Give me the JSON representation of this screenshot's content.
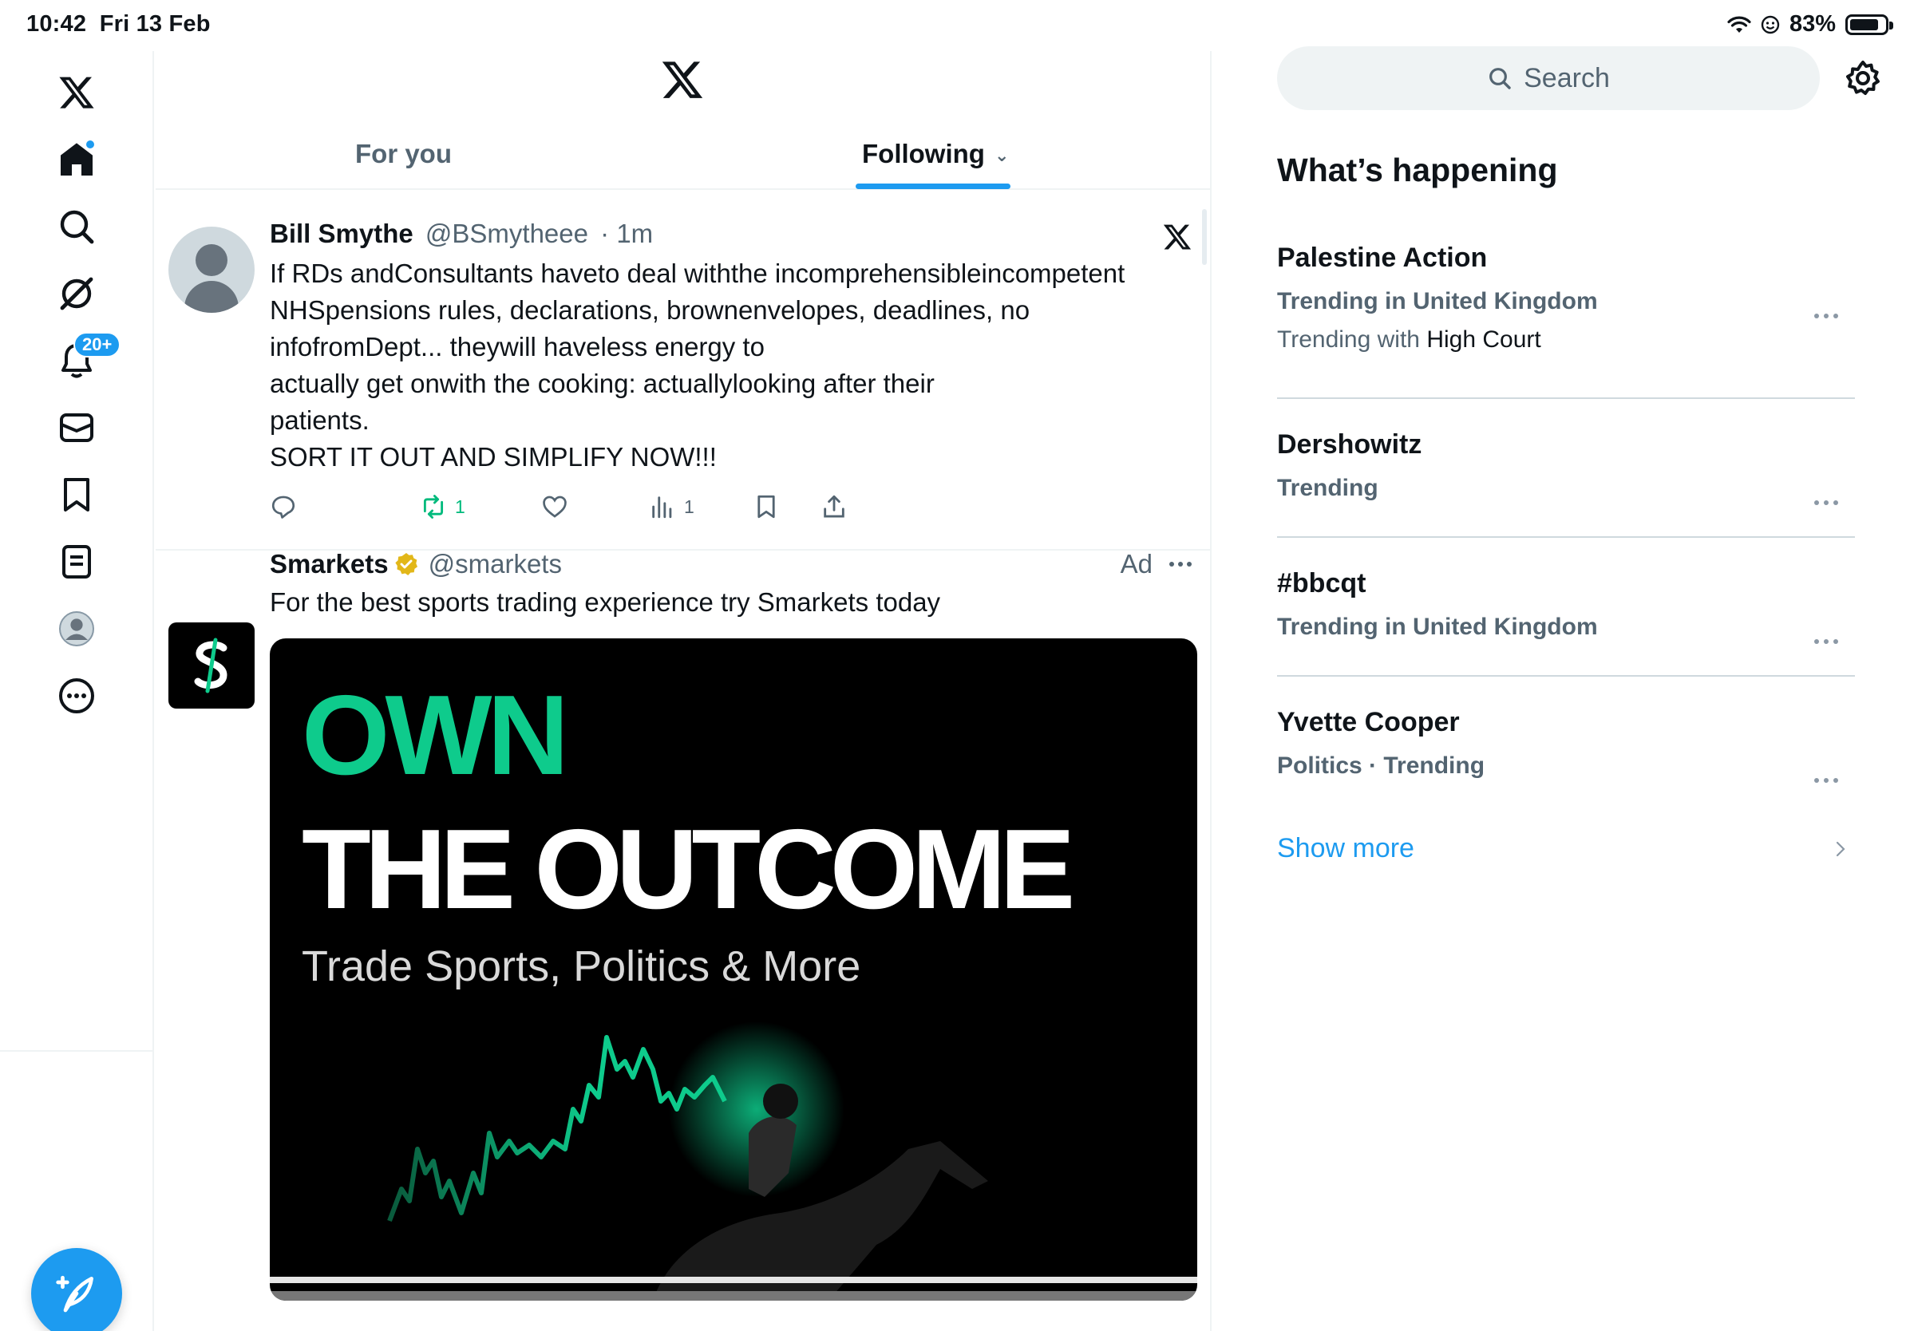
{
  "status": {
    "time": "10:42",
    "date": "Fri 13 Feb",
    "battery": "83%",
    "battery_level": 0.83
  },
  "nav": {
    "notifications_badge": "20+"
  },
  "tabs": {
    "for_you": "For you",
    "following": "Following"
  },
  "tweet": {
    "name": "Bill Smythe",
    "handle": "@BSmytheee",
    "time": "· 1m",
    "lines": [
      "If RDs andConsultants haveto deal withthe incomprehensibleincompetent",
      "NHSpensions rules, declarations, brownenvelopes, deadlines, no",
      "infofromDept... theywill haveless energy to",
      "actually get onwith the cooking: actuallylooking after their",
      "patients.",
      "SORT IT OUT AND SIMPLIFY NOW!!!"
    ],
    "retweets": "1",
    "views": "1"
  },
  "ad": {
    "name": "Smarkets",
    "handle": "@smarkets",
    "tag": "Ad",
    "text": "For the best sports trading experience try Smarkets today",
    "headline1": "OWN",
    "headline2": "THE OUTCOME",
    "subline": "Trade Sports, Politics & More",
    "accent": "#0ecb8c"
  },
  "sidebar": {
    "search_label": "Search",
    "title": "What’s happening",
    "trends": [
      {
        "name": "Palestine Action",
        "meta": "Trending in United Kingdom",
        "with_prefix": "Trending with",
        "with_topic": "High Court"
      },
      {
        "name": "Dershowitz",
        "meta": "Trending"
      },
      {
        "name": "#bbcqt",
        "meta": "Trending in United Kingdom"
      },
      {
        "name": "Yvette Cooper",
        "meta": "Politics · Trending"
      }
    ],
    "show_more": "Show more"
  },
  "colors": {
    "accent": "#1d9bf0",
    "text": "#0f1419",
    "muted": "#536471",
    "retweet": "#00ba7c"
  }
}
